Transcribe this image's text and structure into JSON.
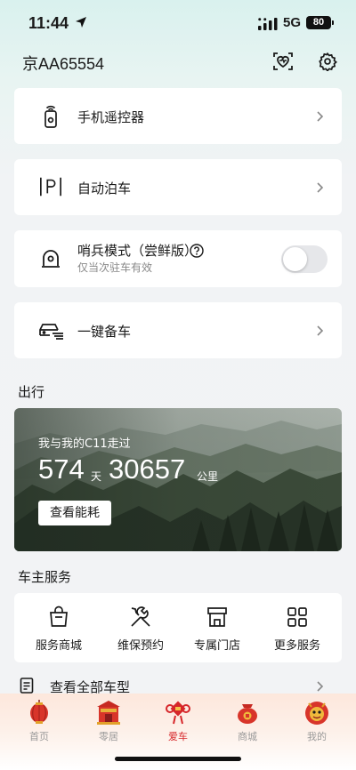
{
  "status_bar": {
    "time": "11:44",
    "network": "5G",
    "battery": "80"
  },
  "header": {
    "plate": "京AA65554"
  },
  "controls": {
    "remote": {
      "label": "手机遥控器"
    },
    "parking": {
      "label": "自动泊车"
    },
    "sentry": {
      "label": "哨兵模式（尝鲜版）",
      "sub": "仅当次驻车有效",
      "enabled": false
    },
    "prep": {
      "label": "一键备车"
    }
  },
  "trip": {
    "section_title": "出行",
    "caption": "我与我的C11走过",
    "days": "574",
    "days_unit": "天",
    "distance": "30657",
    "distance_unit": "公里",
    "button": "查看能耗"
  },
  "services": {
    "section_title": "车主服务",
    "items": [
      {
        "label": "服务商城",
        "icon": "shopping-bag-icon"
      },
      {
        "label": "维保预约",
        "icon": "wrench-icon"
      },
      {
        "label": "专属门店",
        "icon": "store-icon"
      },
      {
        "label": "更多服务",
        "icon": "grid-icon"
      }
    ]
  },
  "all_models": {
    "label": "查看全部车型"
  },
  "tabbar": {
    "active_color": "#d6262a",
    "items": [
      {
        "label": "首页",
        "icon": "lantern-icon"
      },
      {
        "label": "零居",
        "icon": "gate-icon"
      },
      {
        "label": "爱车",
        "icon": "knot-icon",
        "active": true
      },
      {
        "label": "商城",
        "icon": "bag-icon"
      },
      {
        "label": "我的",
        "icon": "lion-icon"
      }
    ]
  }
}
